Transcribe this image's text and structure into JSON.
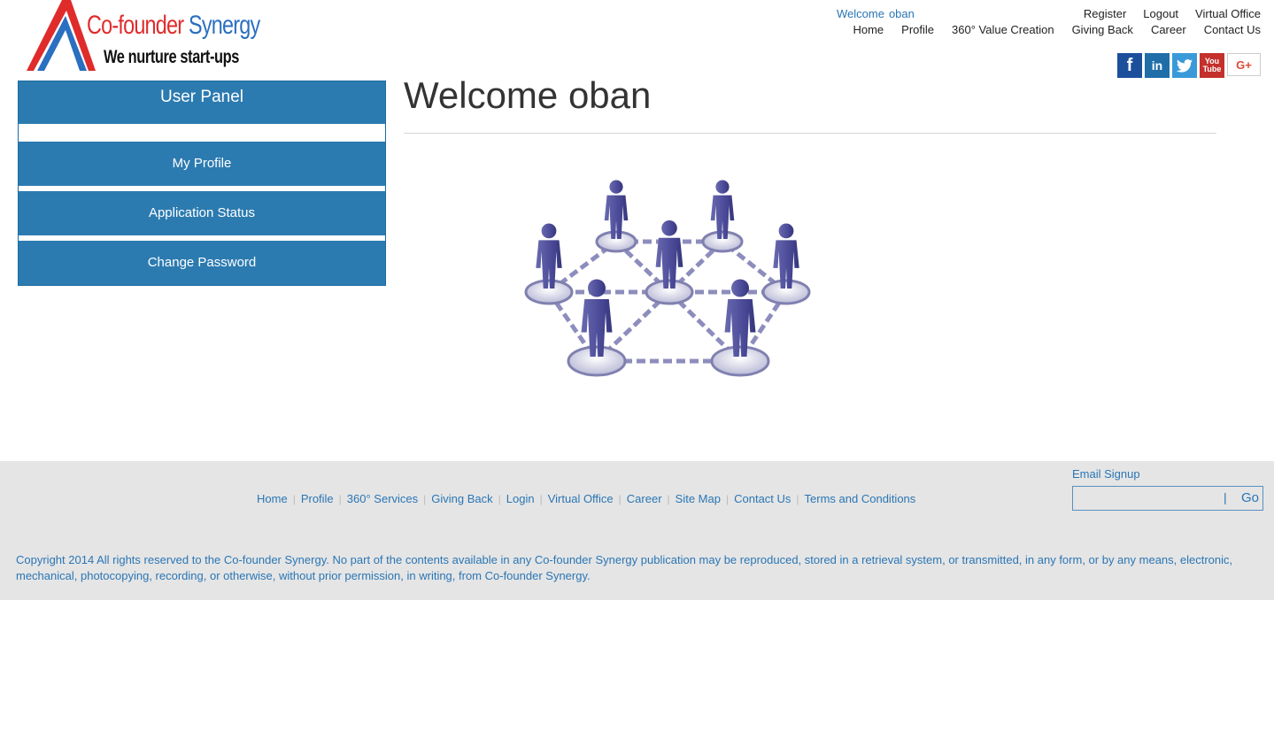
{
  "logo": {
    "name_part1": "Co-founder",
    "name_part2": "Synergy",
    "tagline": "We nurture start-ups"
  },
  "header": {
    "welcome_label": "Welcome",
    "username": "oban",
    "nav_top": [
      "Register",
      "Logout",
      "Virtual Office"
    ],
    "nav_bottom": [
      "Home",
      "Profile",
      "360° Value Creation",
      "Giving Back",
      "Career",
      "Contact Us"
    ]
  },
  "social": {
    "icons": [
      "facebook-icon",
      "linkedin-icon",
      "twitter-icon",
      "youtube-icon",
      "google-plus-icon"
    ],
    "facebook_glyph": "f",
    "linkedin_glyph": "in",
    "youtube_glyph_1": "You",
    "youtube_glyph_2": "Tube",
    "googleplus_glyph": "G+"
  },
  "user_panel": {
    "title": "User Panel",
    "items": [
      "My Profile",
      "Application Status",
      "Change Password"
    ]
  },
  "main": {
    "title": "Welcome oban"
  },
  "footer": {
    "links": [
      "Home",
      "Profile",
      "360° Services",
      "Giving Back",
      "Login",
      "Virtual Office",
      "Career",
      "Site Map",
      "Contact Us",
      "Terms and Conditions"
    ],
    "email_signup_label": "Email Signup",
    "email_placeholder": "",
    "go_label": "Go",
    "copyright": "Copyright 2014 All rights reserved to the Co-founder Synergy. No part of the contents available in any Co-founder Synergy publication may be reproduced, stored in a retrieval system, or transmitted, in any form, or by any means, electronic, mechanical, photocopying, recording, or otherwise, without prior permission, in writing, from Co-founder Synergy."
  },
  "colors": {
    "accent_blue": "#2c7bb0",
    "link_blue": "#2a76b5",
    "logo_red": "#e02b2b",
    "footer_bg": "#e5e5e5"
  }
}
